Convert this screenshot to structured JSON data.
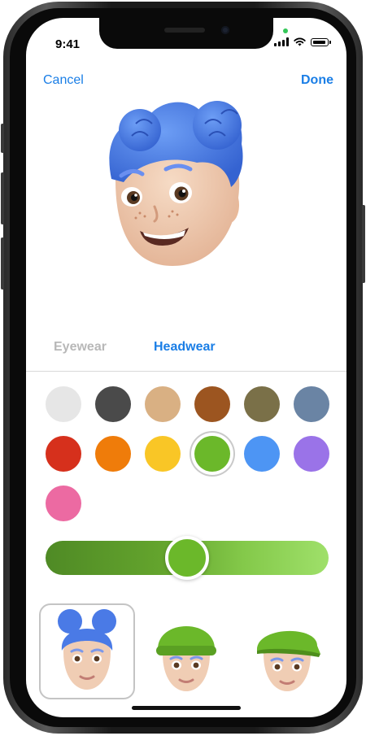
{
  "status": {
    "time": "9:41"
  },
  "nav": {
    "cancel_label": "Cancel",
    "done_label": "Done"
  },
  "tabs": [
    {
      "label": "Eyewear",
      "active": false
    },
    {
      "label": "Headwear",
      "active": true
    }
  ],
  "colors": {
    "accent": "#1a7ee6",
    "swatches": [
      {
        "name": "light-gray",
        "hex": "#e6e6e6",
        "selected": false
      },
      {
        "name": "dark-gray",
        "hex": "#4a4a4a",
        "selected": false
      },
      {
        "name": "tan",
        "hex": "#d9b083",
        "selected": false
      },
      {
        "name": "brown",
        "hex": "#9c5520",
        "selected": false
      },
      {
        "name": "olive",
        "hex": "#7a7048",
        "selected": false
      },
      {
        "name": "slate-blue",
        "hex": "#6a84a4",
        "selected": false
      },
      {
        "name": "red",
        "hex": "#d6301c",
        "selected": false
      },
      {
        "name": "orange",
        "hex": "#ef7c0a",
        "selected": false
      },
      {
        "name": "yellow",
        "hex": "#f9c626",
        "selected": false
      },
      {
        "name": "green",
        "hex": "#6bb82a",
        "selected": true
      },
      {
        "name": "blue",
        "hex": "#4d95f4",
        "selected": false
      },
      {
        "name": "purple",
        "hex": "#9a73e8",
        "selected": false
      },
      {
        "name": "pink",
        "hex": "#ec6aa2",
        "selected": false
      }
    ]
  },
  "slider": {
    "value": 0.5
  },
  "variants": [
    {
      "name": "no-headwear",
      "selected": true
    },
    {
      "name": "beanie",
      "selected": false
    },
    {
      "name": "flat-cap",
      "selected": false
    }
  ]
}
